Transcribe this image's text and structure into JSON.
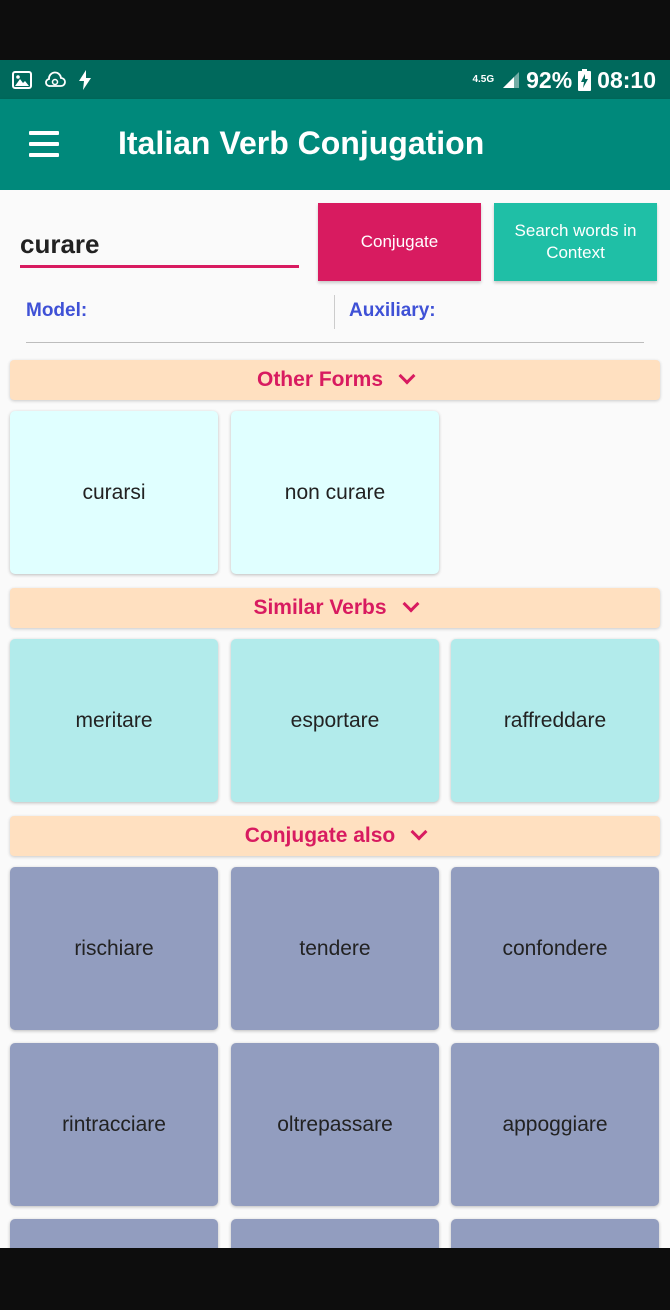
{
  "status": {
    "network": "4.5G",
    "battery": "92%",
    "time": "08:10",
    "left_icons": [
      "image-icon",
      "cloud-sync-icon",
      "charging-icon"
    ]
  },
  "appbar": {
    "title": "Italian Verb Conjugation"
  },
  "search": {
    "value": "curare",
    "conjugate_label": "Conjugate",
    "context_label": "Search words in Context"
  },
  "meta": {
    "model_label": "Model:",
    "auxiliary_label": "Auxiliary:"
  },
  "sections": {
    "other_forms": {
      "title": "Other Forms",
      "items": [
        "curarsi",
        "non curare"
      ]
    },
    "similar_verbs": {
      "title": "Similar Verbs",
      "items": [
        "meritare",
        "esportare",
        "raffreddare"
      ]
    },
    "conjugate_also": {
      "title": "Conjugate also",
      "items": [
        "rischiare",
        "tendere",
        "confondere",
        "rintracciare",
        "oltrepassare",
        "appoggiare"
      ]
    }
  },
  "colors": {
    "appbar": "#00897b",
    "statusbar": "#00695c",
    "accent": "#d81b60",
    "context_button": "#1fbfa6",
    "meta_label": "#3f51d6",
    "section_header": "#ffe0c0"
  }
}
